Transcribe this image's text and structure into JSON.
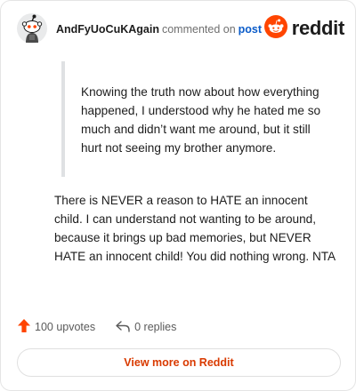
{
  "header": {
    "author": "AndFyUoCuKAgain",
    "commented_text": "commented on",
    "post_link": "post",
    "brand": "reddit"
  },
  "quote": {
    "text": "Knowing the truth now about how everything happened, I understood why he hated me so much and didn’t want me around, but it still hurt not seeing my brother anymore."
  },
  "comment": {
    "text": "There is NEVER a reason to HATE an innocent child. I can understand not wanting to be around, because it brings up bad memories, but NEVER HATE an innocent child! You did nothing wrong. NTA"
  },
  "actions": {
    "upvotes": "100 upvotes",
    "replies": "0 replies"
  },
  "view_more": "View more on Reddit",
  "colors": {
    "reddit_orange": "#ff4500",
    "link_blue": "#0b5cc9",
    "view_more_text": "#d93a00"
  },
  "icons": {
    "avatar": "snoo-avatar-icon",
    "brand": "reddit-logo-icon",
    "upvote": "upvote-arrow-icon",
    "reply": "reply-arrow-icon"
  }
}
